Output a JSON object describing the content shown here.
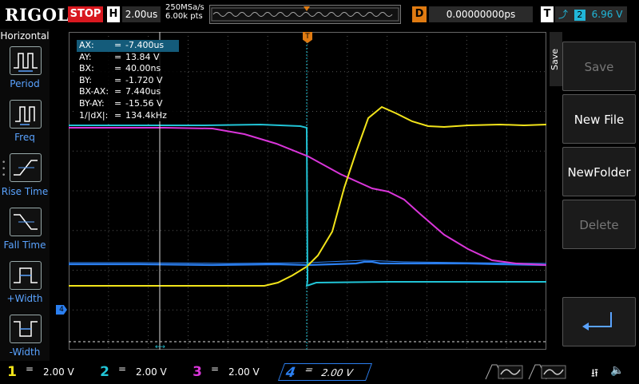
{
  "header": {
    "brand": "RIGOL",
    "run_state": "STOP",
    "horizontal_label": "H",
    "timebase": "2.00us",
    "sample_rate": "250MSa/s",
    "memory_depth": "6.00k pts",
    "delay_label": "D",
    "delay_value": "0.00000000ps",
    "trigger_label": "T",
    "trigger_channel": "2",
    "trigger_level": "6.96 V"
  },
  "left_menu": {
    "title": "Horizontal",
    "items": [
      {
        "label": "Period"
      },
      {
        "label": "Freq"
      },
      {
        "label": "Rise Time"
      },
      {
        "label": "Fall Time"
      },
      {
        "label": "+Width"
      },
      {
        "label": "-Width"
      }
    ]
  },
  "cursor_info": {
    "rows": [
      {
        "name": "AX:",
        "eq": "=",
        "value": "-7.400us"
      },
      {
        "name": "AY:",
        "eq": "=",
        "value": "13.84 V"
      },
      {
        "name": "BX:",
        "eq": "=",
        "value": "40.00ns"
      },
      {
        "name": "BY:",
        "eq": "=",
        "value": "-1.720 V"
      },
      {
        "name": "BX-AX:",
        "eq": "=",
        "value": "7.440us"
      },
      {
        "name": "BY-AY:",
        "eq": "=",
        "value": "-15.56 V"
      },
      {
        "name": "1/|dX|:",
        "eq": "=",
        "value": "134.4kHz"
      }
    ]
  },
  "right_menu": {
    "section": "Save",
    "buttons": [
      {
        "label": "Save",
        "enabled": false
      },
      {
        "label": "New File",
        "enabled": true
      },
      {
        "label": "NewFolder",
        "enabled": true
      },
      {
        "label": "Delete",
        "enabled": false
      }
    ]
  },
  "channels": [
    {
      "num": "1",
      "coupling": "=",
      "scale": "2.00 V",
      "color": "#f2e41a"
    },
    {
      "num": "2",
      "coupling": "=",
      "scale": "2.00 V",
      "color": "#21c4d6"
    },
    {
      "num": "3",
      "coupling": "=",
      "scale": "2.00 V",
      "color": "#d935d9"
    },
    {
      "num": "4",
      "coupling": "=",
      "scale": "2.00 V",
      "color": "#2b7ff0"
    }
  ],
  "markers": {
    "ch4_ground": "4"
  },
  "colors": {
    "ch1": "#f2e41a",
    "ch2": "#21c4d6",
    "ch3": "#d935d9",
    "ch4": "#2b7ff0",
    "trigger_marker": "#e07b12",
    "stop": "#d8181f"
  }
}
